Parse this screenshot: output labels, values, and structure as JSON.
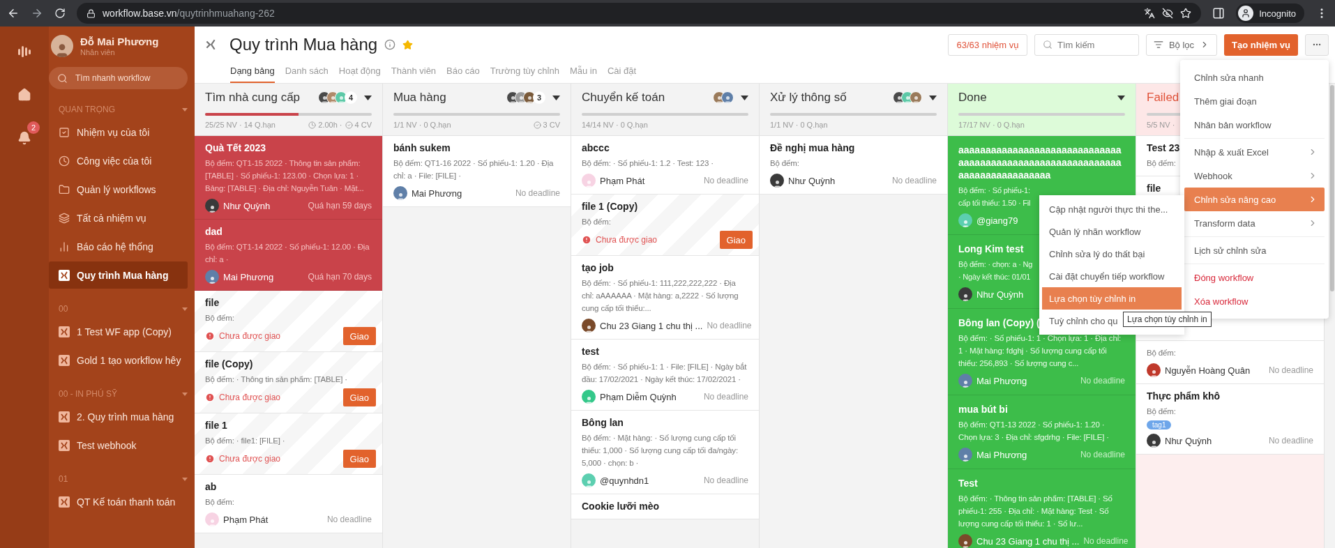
{
  "browser": {
    "url_host": "workflow.base.vn",
    "url_path": "/quytrinhmuahang-262",
    "profile": "Incognito"
  },
  "rail": {
    "notifications": "2"
  },
  "sidebar": {
    "user": {
      "name": "Đỗ Mai Phương",
      "role": "Nhân viên"
    },
    "search": {
      "placeholder": "Tìm nhanh workflow"
    },
    "sections": [
      {
        "title": "QUAN TRỌNG",
        "items": [
          {
            "label": "Nhiệm vụ của tôi",
            "selected": false
          },
          {
            "label": "Công việc của tôi",
            "selected": false
          },
          {
            "label": "Quản lý workflows",
            "selected": false
          },
          {
            "label": "Tất cả nhiệm vụ",
            "selected": false
          },
          {
            "label": "Báo cáo hệ thống",
            "selected": false
          },
          {
            "label": "Quy trình Mua hàng",
            "selected": true
          }
        ]
      },
      {
        "title": "00",
        "items": [
          {
            "label": "1 Test WF app (Copy)",
            "selected": false
          },
          {
            "label": "Gold 1 tạo workflow hêy",
            "selected": false
          }
        ]
      },
      {
        "title": "00 - IN PHÚ SỸ",
        "items": [
          {
            "label": "2. Quy trình mua hàng",
            "selected": false
          },
          {
            "label": "Test webhook",
            "selected": false
          }
        ]
      },
      {
        "title": "01",
        "items": [
          {
            "label": "QT Kế toán thanh toán",
            "selected": false
          }
        ]
      }
    ]
  },
  "header": {
    "title": "Quy trình Mua hàng",
    "starred": true,
    "tabs": [
      {
        "label": "Dạng bảng",
        "selected": true
      },
      {
        "label": "Danh sách",
        "selected": false
      },
      {
        "label": "Hoạt động",
        "selected": false
      },
      {
        "label": "Thành viên",
        "selected": false
      },
      {
        "label": "Báo cáo",
        "selected": false
      },
      {
        "label": "Trường tùy chỉnh",
        "selected": false
      },
      {
        "label": "Mẫu in",
        "selected": false
      },
      {
        "label": "Cài đặt",
        "selected": false
      }
    ],
    "task_count": "63/63 nhiệm vụ",
    "search": {
      "placeholder": "Tìm kiếm"
    },
    "filter": "Bộ lọc",
    "create": "Tạo nhiệm vụ"
  },
  "columns": [
    {
      "title": "Tìm nhà cung cấp",
      "kind": "normal",
      "avatars": [
        {
          "color": "#4a4a4a"
        },
        {
          "color": "#b08a6a"
        },
        {
          "color": "#5cc9a7"
        }
      ],
      "member_count": "4",
      "level": 0.56,
      "stats": "25/25 NV · 14 Q.hạn",
      "hours": "2.00h ·",
      "jobs": "4 CV",
      "cards": [
        {
          "kind": "overdue",
          "title": "Quà Tết 2023",
          "desc": "Bộ đếm: QT1-15 2022 · Thông tin sản phẩm: [TABLE] · Số phiếu-1: 123.00 · Chọn lựa: 1 · Bảng: [TABLE] · Địa chỉ: Nguyễn Tuân · Mặt...",
          "assignee": {
            "name": "Như Quỳnh",
            "color": "#3a3a3a"
          },
          "deadline": "Quá hạn 59 days"
        },
        {
          "kind": "overdue",
          "title": "dad",
          "desc": "Bộ đếm: QT1-14 2022 · Số phiếu-1: 12.00 · Địa chỉ: a ·",
          "assignee": {
            "name": "Mai Phương",
            "color": "#5f7fa8"
          },
          "deadline": "Quá hạn 70 days"
        },
        {
          "kind": "unassigned",
          "title": "file",
          "desc": "Bộ đếm:",
          "status": "Chưa được giao",
          "action": "Giao"
        },
        {
          "kind": "unassigned",
          "title": "file (Copy)",
          "desc": "Bộ đếm: · Thông tin sản phẩm: [TABLE] ·",
          "status": "Chưa được giao",
          "action": "Giao"
        },
        {
          "kind": "unassigned",
          "title": "file 1",
          "desc": "Bộ đếm: · file1: [FILE] ·",
          "status": "Chưa được giao",
          "action": "Giao"
        },
        {
          "kind": "normal",
          "title": "ab",
          "desc": "Bộ đếm:",
          "assignee": {
            "name": "Phạm Phát",
            "color": "#f7d3e3"
          },
          "deadline": "No deadline"
        }
      ]
    },
    {
      "title": "Mua hàng",
      "kind": "normal",
      "avatars": [
        {
          "color": "#4a4a4a"
        },
        {
          "color": "#9a9a9a"
        },
        {
          "color": "#7a5a3a"
        }
      ],
      "member_count": "3",
      "stats": "1/1 NV · 0 Q.hạn",
      "jobs": "3 CV",
      "cards": [
        {
          "kind": "normal",
          "title": "bánh sukem",
          "desc": "Bộ đếm: QT1-16 2022 · Số phiếu-1: 1.20 · Địa chỉ: a · File: [FILE] ·",
          "assignee": {
            "name": "Mai Phương",
            "color": "#5f7fa8"
          },
          "deadline": "No deadline"
        }
      ]
    },
    {
      "title": "Chuyển kế toán",
      "kind": "normal",
      "avatars": [
        {
          "color": "#9a7a5a"
        },
        {
          "color": "#5f7fa8"
        }
      ],
      "stats": "14/14 NV · 0 Q.hạn",
      "cards": [
        {
          "kind": "normal",
          "title": "abccc",
          "desc": "Bộ đếm: · Số phiếu-1: 1.2 · Test: 123 ·",
          "assignee": {
            "name": "Phạm Phát",
            "color": "#f7d3e3"
          },
          "deadline": "No deadline"
        },
        {
          "kind": "unassigned",
          "title": "file 1 (Copy)",
          "desc": "Bộ đếm:",
          "status": "Chưa được giao",
          "action": "Giao"
        },
        {
          "kind": "normal",
          "title": "tạo job",
          "desc": "Bộ đếm: · Số phiếu-1: 111,222,222,222 · Địa chỉ: aAAAAAA · Mặt hàng: a,2222 · Số lượng cung cấp tối thiểu:...",
          "assignee": {
            "name": "Chu 23 Giang 1 chu thị ...",
            "color": "#7a4a2a"
          },
          "deadline": "No deadline"
        },
        {
          "kind": "normal",
          "title": "test",
          "desc": "Bộ đếm: · Số phiếu-1: 1 · File: [FILE] · Ngày bắt đầu: 17/02/2021 · Ngày kết thúc: 17/02/2021 ·",
          "assignee": {
            "name": "Phạm Diễm Quỳnh",
            "color": "#34c88a"
          },
          "deadline": "No deadline"
        },
        {
          "kind": "normal",
          "title": "Bông lan",
          "desc": "Bộ đếm: · Mặt hàng: · Số lượng cung cấp tối thiểu: 1,000 · Số lượng cung cấp tối đa/ngày: 5,000 · chọn: b ·",
          "assignee": {
            "name": "@quynhdn1",
            "color": "#5ccfb0"
          },
          "deadline": "No deadline"
        },
        {
          "kind": "normal",
          "title": "Cookie lưỡi mèo"
        }
      ]
    },
    {
      "title": "Xử lý thông số",
      "kind": "normal",
      "avatars": [
        {
          "color": "#4a4a4a"
        },
        {
          "color": "#5cc9a7"
        },
        {
          "color": "#9a7a5a"
        }
      ],
      "stats": "1/1 NV · 0 Q.hạn",
      "cards": [
        {
          "kind": "normal",
          "title": "Đề nghị mua hàng",
          "desc": "Bộ đếm:",
          "assignee": {
            "name": "Như Quỳnh",
            "color": "#3a3a3a"
          },
          "deadline": "No deadline"
        }
      ]
    },
    {
      "title": "Done",
      "kind": "done",
      "stats": "17/17 NV · 0 Q.hạn",
      "cards": [
        {
          "kind": "done",
          "title": "aaaaaaaaaaaaaaaaaaaaaaaaaaaaaaaaaaaaaaaaaaaaaaaaaaaaaaaaaaaaaaaaaaaaaaaaaaaaa",
          "desc_lines": [
            "Bộ đếm: · Số phiếu-1:",
            "cấp tối thiểu: 1.50 · Fil"
          ],
          "assignee": {
            "name": "@giang79",
            "color": "#5ccfb0"
          }
        },
        {
          "kind": "done",
          "title": "Long Kim test",
          "desc_lines": [
            "Bộ đếm: · chọn: a · Ng",
            "· Ngày kết thúc: 01/01"
          ],
          "assignee": {
            "name": "Như Quỳnh",
            "color": "#3a3a3a"
          }
        },
        {
          "kind": "done",
          "title": "Bông lan (Copy) (",
          "desc": "Bộ đếm: · Số phiếu-1: 1 · Chọn lựa: 1 · Địa chỉ: 1 · Mặt hàng: fdghj · Số lượng cung cấp tối thiểu: 256,893 · Số lượng cung c...",
          "assignee": {
            "name": "Mai Phương",
            "color": "#5f7fa8"
          },
          "deadline": "No deadline"
        },
        {
          "kind": "done",
          "title": "mua bút bi",
          "desc": "Bộ đếm: QT1-13 2022 · Số phiếu-1: 1.20 · Chọn lựa: 3 · Địa chỉ: sfgdrhg · File: [FILE] ·",
          "assignee": {
            "name": "Mai Phương",
            "color": "#5f7fa8"
          },
          "deadline": "No deadline"
        },
        {
          "kind": "done",
          "title": "Test",
          "desc": "Bộ đếm: · Thông tin sản phẩm: [TABLE] · Số phiếu-1: 255 · Địa chỉ: · Mặt hàng: Test · Số lượng cung cấp tối thiểu: 1 · Số lư...",
          "assignee": {
            "name": "Chu 23 Giang 1 chu thị ...",
            "color": "#7a4a2a"
          },
          "deadline": "No deadline"
        }
      ]
    },
    {
      "title": "Failed",
      "kind": "failed",
      "stats": "5/5 NV ·",
      "cards": [
        {
          "kind": "normal",
          "title": "Test 23",
          "desc": "Bộ đếm:"
        },
        {
          "kind": "normal",
          "title": "file"
        },
        {
          "kind": "normal",
          "desc": "Bộ đếm:",
          "assignee": {
            "name": "Nguyễn Hoàng Quân",
            "color": "#c0392b"
          },
          "deadline": "No deadline"
        },
        {
          "kind": "normal",
          "title": "Thực phẩm khô",
          "desc": "Bộ đếm:",
          "tags": [
            "tag1"
          ],
          "assignee": {
            "name": "Như Quỳnh",
            "color": "#3a3a3a"
          },
          "deadline": "No deadline"
        }
      ]
    }
  ],
  "menu": {
    "groups": [
      [
        {
          "label": "Chỉnh sửa nhanh",
          "kind": "action",
          "selected": false
        },
        {
          "label": "Thêm giai đoạn",
          "kind": "action",
          "selected": false
        },
        {
          "label": "Nhân bản workflow",
          "kind": "action",
          "selected": false
        }
      ],
      [
        {
          "label": "Nhập & xuất Excel",
          "kind": "submenu",
          "selected": false
        },
        {
          "label": "Webhook",
          "kind": "submenu",
          "selected": false
        },
        {
          "label": "Chỉnh sửa nâng cao",
          "kind": "submenu",
          "selected": true
        },
        {
          "label": "Transform data",
          "kind": "submenu",
          "selected": false
        }
      ],
      [
        {
          "label": "Lịch sử chỉnh sửa",
          "kind": "action",
          "selected": false
        }
      ],
      [
        {
          "label": "Đóng workflow",
          "kind": "danger",
          "selected": false
        },
        {
          "label": "Xóa workflow",
          "kind": "danger",
          "selected": false
        }
      ]
    ]
  },
  "submenu": {
    "items": [
      {
        "label": "Cập nhật người thực thi the...",
        "selected": false
      },
      {
        "label": "Quản lý nhãn workflow",
        "selected": false
      },
      {
        "label": "Chỉnh sửa lý do thất bại",
        "selected": false
      },
      {
        "label": "Cài đặt chuyển tiếp workflow",
        "selected": false
      },
      {
        "label": "Lựa chọn tùy chỉnh in",
        "selected": true
      },
      {
        "label": "Tuỳ chỉnh cho qu",
        "selected": false
      }
    ]
  },
  "tooltip": "Lựa chọn tùy chỉnh in"
}
